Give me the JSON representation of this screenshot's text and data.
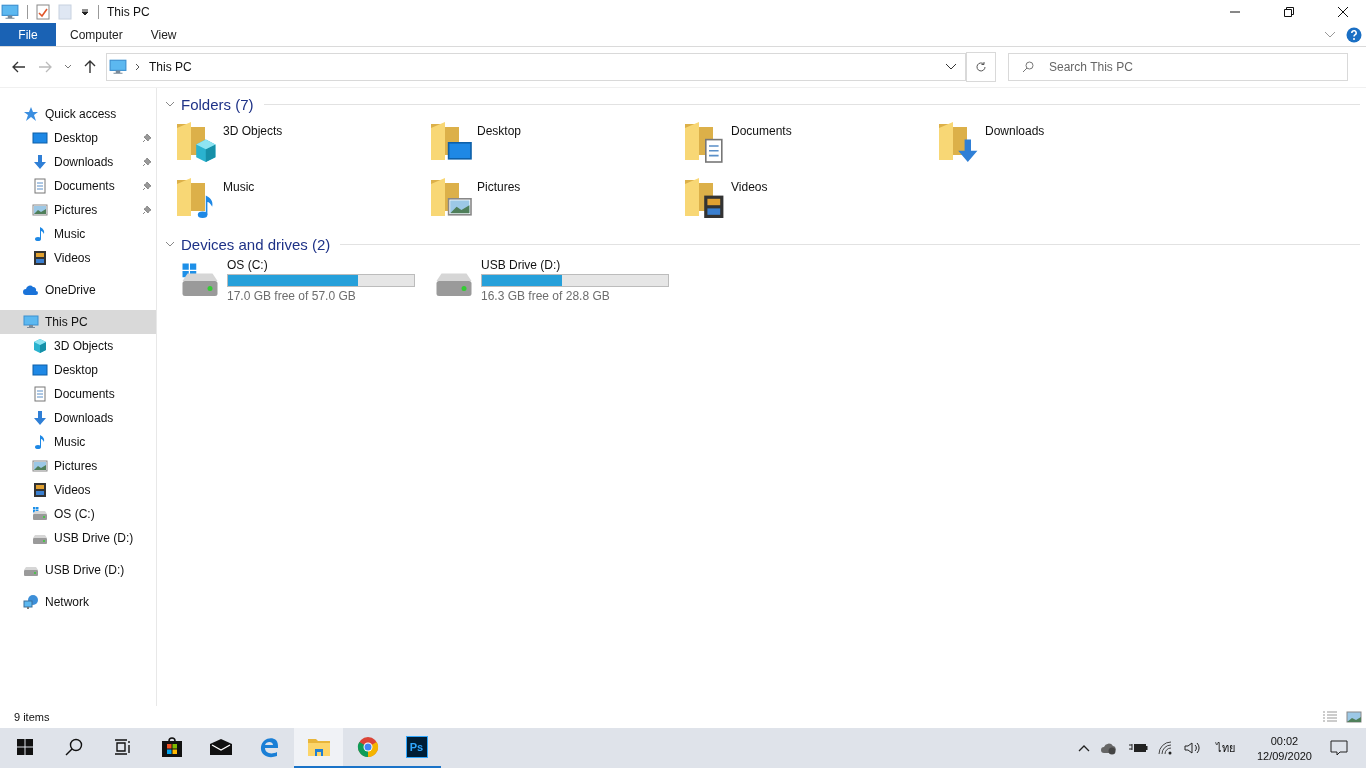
{
  "window": {
    "title": "This PC"
  },
  "ribbon": {
    "file_button": "File",
    "tabs": [
      {
        "label": "Computer",
        "selected": false
      },
      {
        "label": "View",
        "selected": false
      }
    ]
  },
  "address_bar": {
    "path": "This PC"
  },
  "search": {
    "placeholder": "Search This PC"
  },
  "sidebar": {
    "items": [
      {
        "label": "Quick access",
        "kind": "star",
        "selected": false,
        "children": [
          {
            "label": "Desktop",
            "kind": "desktop",
            "pinned": true,
            "selected": false
          },
          {
            "label": "Downloads",
            "kind": "downloads",
            "pinned": true,
            "selected": false
          },
          {
            "label": "Documents",
            "kind": "documents",
            "pinned": true,
            "selected": false
          },
          {
            "label": "Pictures",
            "kind": "pictures",
            "pinned": true,
            "selected": false
          },
          {
            "label": "Music",
            "kind": "music",
            "pinned": false,
            "selected": false
          },
          {
            "label": "Videos",
            "kind": "videos",
            "pinned": false,
            "selected": false
          }
        ]
      },
      {
        "label": "OneDrive",
        "kind": "cloud",
        "selected": false
      },
      {
        "label": "This PC",
        "kind": "pc",
        "selected": true,
        "children": [
          {
            "label": "3D Objects",
            "kind": "cube",
            "pinned": false,
            "selected": false
          },
          {
            "label": "Desktop",
            "kind": "desktop",
            "pinned": false,
            "selected": false
          },
          {
            "label": "Documents",
            "kind": "documents",
            "pinned": false,
            "selected": false
          },
          {
            "label": "Downloads",
            "kind": "downloads",
            "pinned": false,
            "selected": false
          },
          {
            "label": "Music",
            "kind": "music",
            "pinned": false,
            "selected": false
          },
          {
            "label": "Pictures",
            "kind": "pictures",
            "pinned": false,
            "selected": false
          },
          {
            "label": "Videos",
            "kind": "videos",
            "pinned": false,
            "selected": false
          },
          {
            "label": "OS (C:)",
            "kind": "os-drive",
            "pinned": false,
            "selected": false
          },
          {
            "label": "USB Drive (D:)",
            "kind": "drive",
            "pinned": false,
            "selected": false
          }
        ]
      },
      {
        "label": "USB Drive (D:)",
        "kind": "drive",
        "selected": false
      },
      {
        "label": "Network",
        "kind": "network",
        "selected": false
      }
    ]
  },
  "folders": {
    "heading": "Folders (7)",
    "expanded": true,
    "items": [
      {
        "label": "3D Objects",
        "kind": "cube"
      },
      {
        "label": "Desktop",
        "kind": "desktop"
      },
      {
        "label": "Documents",
        "kind": "documents"
      },
      {
        "label": "Downloads",
        "kind": "downloads"
      },
      {
        "label": "Music",
        "kind": "music"
      },
      {
        "label": "Pictures",
        "kind": "pictures"
      },
      {
        "label": "Videos",
        "kind": "videos"
      }
    ]
  },
  "drives": {
    "heading": "Devices and drives (2)",
    "expanded": true,
    "items": [
      {
        "label": "OS (C:)",
        "kind": "os-drive",
        "level": 0.7,
        "space": "17.0 GB free of 57.0 GB"
      },
      {
        "label": "USB Drive (D:)",
        "kind": "drive",
        "level": 0.43,
        "space": "16.3 GB free of 28.8 GB"
      }
    ]
  },
  "status_bar": {
    "count": "9 items"
  },
  "taskbar": {
    "apps": [
      {
        "kind": "store",
        "open": false,
        "selected": false
      },
      {
        "kind": "mail",
        "open": false,
        "selected": false
      },
      {
        "kind": "edge",
        "open": false,
        "selected": false
      },
      {
        "kind": "explorer",
        "open": true,
        "selected": true
      },
      {
        "kind": "chrome",
        "open": true,
        "selected": false
      },
      {
        "kind": "photoshop",
        "label": "Ps",
        "open": true,
        "selected": false
      }
    ],
    "language": "ไทย",
    "time": "00:02",
    "date": "12/09/2020"
  }
}
